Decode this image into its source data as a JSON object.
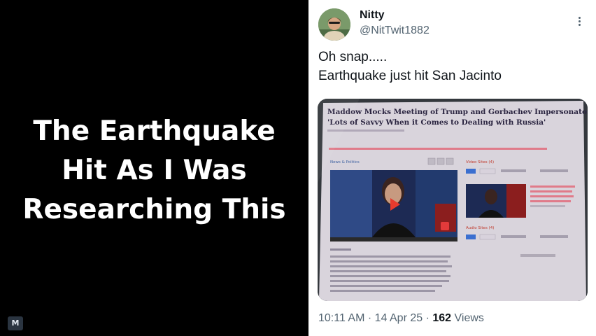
{
  "headline": {
    "lines": [
      "The Earthquake",
      "Hit As I Was",
      "Researching This"
    ]
  },
  "watermark": {
    "logo_text": "M"
  },
  "tweet": {
    "user": {
      "name": "Nitty",
      "handle": "@NitTwit1882"
    },
    "text_lines": [
      "Oh snap.....",
      "Earthquake just hit San Jacinto"
    ],
    "media": {
      "headline_line1": "Maddow Mocks Meeting of Trump and Gorbachev Impersonator in 1987:",
      "headline_line2": "'Lots of Savvy When it Comes to Dealing with Russia'",
      "video_section_label": "Video Sites (4)",
      "audio_section_label": "Audio Sites (4)",
      "news_tab_label": "News & Politics"
    },
    "timestamp": "10:11 AM · 14 Apr 25 · ",
    "views_count": "162",
    "views_label": " Views"
  },
  "colors": {
    "left_background": "#000000",
    "headline_text": "#ffffff",
    "tweet_background": "#ffffff",
    "primary_text": "#0f1419",
    "secondary_text": "#536471"
  },
  "icons": {
    "more_menu": "more-vertical-icon",
    "play": "play-icon"
  }
}
